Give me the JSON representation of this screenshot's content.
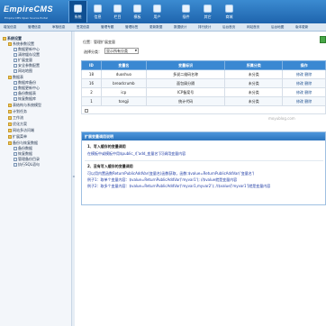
{
  "header": {
    "logo": "EmpireCMS",
    "logo_sub": "Empire CMS Open Source Portal",
    "tabs": [
      "系统",
      "信息",
      "栏目",
      "模板",
      "用户",
      "插件",
      "其它",
      "商城"
    ],
    "active_index": 0
  },
  "subnav": [
    "增加信息",
    "管理信息",
    "审核信息",
    "签发信息",
    "管理专题",
    "管理标签",
    "更新数据",
    "数据统计",
    "排行统计",
    "后台首页",
    "网站首页",
    "后台地图",
    "版本更新"
  ],
  "sidebar": {
    "items": [
      "系统设置",
      "系统参数设置",
      "数据更新中心",
      "清除缓存设置",
      "扩展变量",
      "安全参数配置",
      "网站地图",
      "数据表",
      "数据库备份",
      "数据更新中心",
      "备份数据表",
      "恢复数据库",
      "表结构与系统模型",
      "计划任务",
      "工作流",
      "优化方案",
      "网站多访问端",
      "扩展菜单",
      "备份与恢复数据",
      "备份数据",
      "恢复数据",
      "管理备份目录",
      "执行SQL语句"
    ]
  },
  "main": {
    "breadcrumb": "位置：管理扩展变量",
    "filter_label": "选择分类：",
    "filter_value": "显示所有分类",
    "columns": [
      "ID",
      "变量名",
      "变量标识",
      "所属分类",
      "操作"
    ],
    "rows": [
      {
        "id": "18",
        "name": "duoshuo",
        "label": "多说二维码名称",
        "cat": "未分类",
        "op": "修改 删除"
      },
      {
        "id": "16",
        "name": "breadcrumb",
        "label": "面包屑分隔",
        "cat": "未分类",
        "op": "修改 删除"
      },
      {
        "id": "2",
        "name": "icp",
        "label": "ICP备案号",
        "cat": "未分类",
        "op": "修改 删除"
      },
      {
        "id": "1",
        "name": "tongji",
        "label": "统计代码",
        "cat": "未分类",
        "op": "修改 删除"
      }
    ],
    "watermark": "moyublog.com"
  },
  "help": {
    "title": "扩展变量调用说明",
    "s1_title": "1、写入缓存的变量调用",
    "s1_text": "在模板中或模板中用$public_r['add_变量名']可调用变量内容",
    "s2_title": "2、没有写入缓存的变量调用",
    "s2_text1": "可以用内置函数ReturnPublicAddVar(变量名)函数获取，函数:$value=ReturnPublicAddVar('变量名')",
    "s2_text2": "例子1：取单个变量内容：$value=ReturnPublicAddVar('myvar1'); //$value就是变量内容",
    "s2_text3": "例子2：取多个变量内容：$value=ReturnPublicAddVar('myvar1,myvar2'); //$value['myvar1']就是变量内容"
  }
}
